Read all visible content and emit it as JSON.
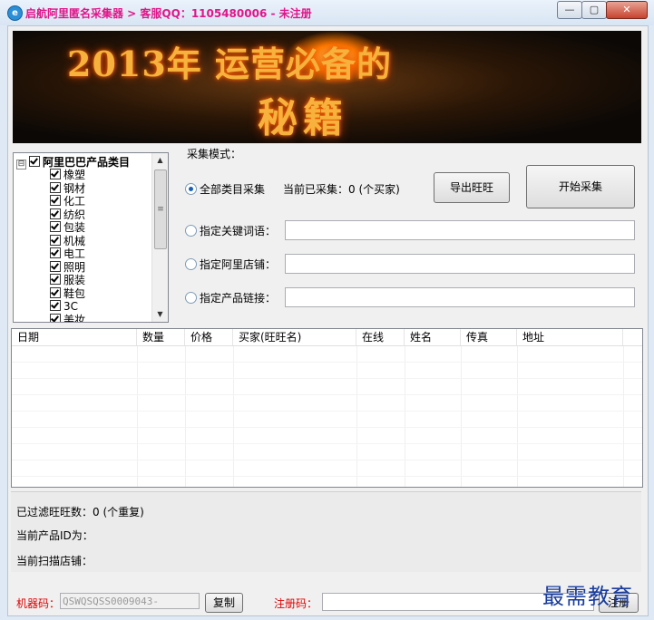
{
  "window": {
    "title": "启航阿里匿名采集器 > 客服QQ：1105480006 - 未注册",
    "app_icon": "e",
    "min": "—",
    "max": "▢",
    "close": "✕"
  },
  "banner": {
    "line1": "2013年 运营必备的",
    "line2": "秘籍"
  },
  "tree": {
    "root_label": "阿里巴巴产品类目",
    "expander": "⊟",
    "items": [
      "橡塑",
      "钢材",
      "化工",
      "纺织",
      "包装",
      "机械",
      "电工",
      "照明",
      "服装",
      "鞋包",
      "3C",
      "美妆"
    ],
    "scroll_up": "▲",
    "scroll_down": "▼",
    "scroll_grip": "≡"
  },
  "mode": {
    "group_label": "采集模式：",
    "all_category": "全部类目采集",
    "collected_status": "当前已采集：0 (个买家)",
    "keyword": "指定关键词语：",
    "shop": "指定阿里店铺：",
    "product_link": "指定产品链接：",
    "keyword_value": "",
    "shop_value": "",
    "product_link_value": ""
  },
  "buttons": {
    "export_wangwang": "导出旺旺",
    "start_collect": "开始采集",
    "copy": "复制",
    "register": "注册"
  },
  "grid": {
    "columns": [
      "日期",
      "数量",
      "价格",
      "买家(旺旺名)",
      "在线",
      "姓名",
      "传真",
      "地址"
    ],
    "rows": []
  },
  "status": {
    "filtered": "已过滤旺旺数：0 (个重复)",
    "current_product_id": "当前产品ID为：",
    "current_shop": "当前扫描店铺："
  },
  "registration": {
    "machine_code_label": "机器码：",
    "machine_code_value": "QSWQSQSS0009043-",
    "reg_code_label": "注册码：",
    "reg_code_value": ""
  },
  "watermark": "最需教育"
}
